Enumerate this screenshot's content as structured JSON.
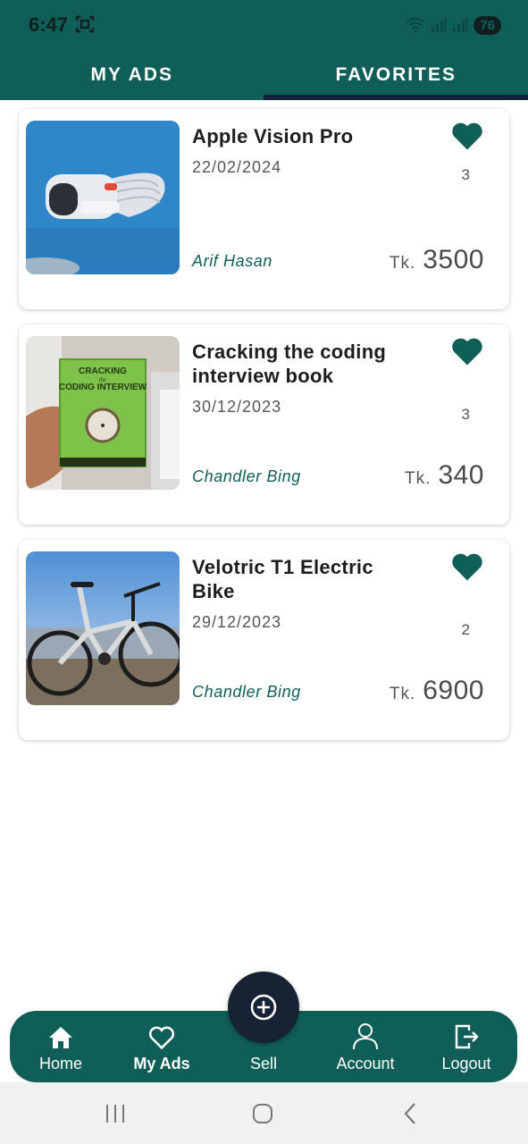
{
  "status": {
    "time": "6:47",
    "battery": "76"
  },
  "tabs": [
    {
      "label": "MY ADS",
      "active": false
    },
    {
      "label": "FAVORITES",
      "active": true
    }
  ],
  "ads": [
    {
      "title": "Apple Vision Pro",
      "date": "22/02/2024",
      "seller": "Arif Hasan",
      "currency": "Tk.",
      "price": "3500",
      "favorites": "3",
      "image": "vr-headset-photo"
    },
    {
      "title": "Cracking the coding interview book",
      "date": "30/12/2023",
      "seller": "Chandler Bing",
      "currency": "Tk.",
      "price": "340",
      "favorites": "3",
      "image": "book-photo"
    },
    {
      "title": "Velotric T1 Electric Bike",
      "date": "29/12/2023",
      "seller": "Chandler Bing",
      "currency": "Tk.",
      "price": "6900",
      "favorites": "2",
      "image": "bike-photo"
    }
  ],
  "book_cover": {
    "line1": "CRACKING",
    "line2": "the",
    "line3": "CODING INTERVIEW"
  },
  "bottom_nav": {
    "items": [
      {
        "label": "Home",
        "icon": "home-icon",
        "active": false
      },
      {
        "label": "My Ads",
        "icon": "heart-outline-icon",
        "active": true
      },
      {
        "label": "Sell",
        "icon": "plus-circle-icon",
        "active": false
      },
      {
        "label": "Account",
        "icon": "person-icon",
        "active": false
      },
      {
        "label": "Logout",
        "icon": "logout-icon",
        "active": false
      }
    ]
  },
  "colors": {
    "primary": "#0f5f58",
    "fab": "#182235",
    "indicator": "#14233a"
  }
}
